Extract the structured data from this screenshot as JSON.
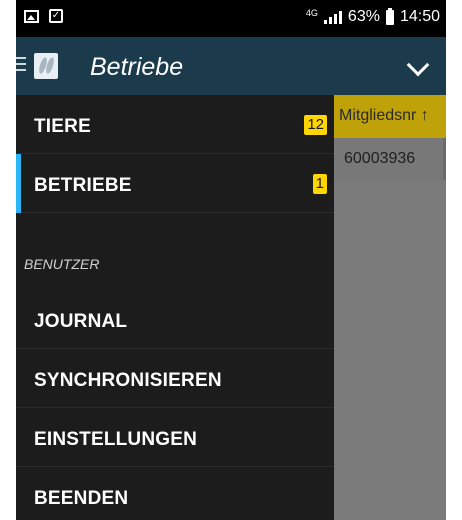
{
  "status_bar": {
    "network": "4G",
    "battery": "63%",
    "time": "14:50"
  },
  "header": {
    "title": "Betriebe"
  },
  "table": {
    "column_header": "Mitgliedsnr ↑",
    "cell_value": "60003936"
  },
  "drawer": {
    "items": [
      {
        "label": "TIERE",
        "badge": "12"
      },
      {
        "label": "BETRIEBE",
        "badge": "1"
      }
    ],
    "section_label": "BENUTZER",
    "user_items": [
      {
        "label": "JOURNAL"
      },
      {
        "label": "SYNCHRONISIEREN"
      },
      {
        "label": "EINSTELLUNGEN"
      },
      {
        "label": "BEENDEN"
      }
    ]
  },
  "colors": {
    "header_bg": "#1b3a4b",
    "badge": "#ffd600",
    "active_indicator": "#29b6f6",
    "drawer_bg": "#1c1c1c"
  }
}
